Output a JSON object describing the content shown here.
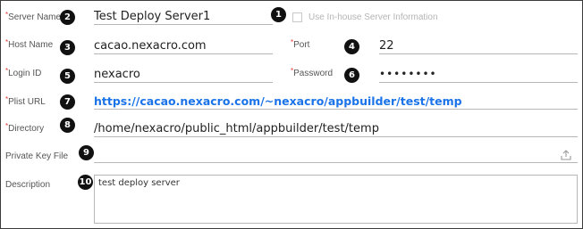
{
  "server_name": {
    "label": "Server Name",
    "value": "Test Deploy Server1",
    "badge": "2"
  },
  "use_inhouse": {
    "label": "Use In-house Server Information",
    "badge": "1",
    "checked": false
  },
  "host_name": {
    "label": "Host Name",
    "value": "cacao.nexacro.com",
    "badge": "3"
  },
  "port": {
    "label": "Port",
    "value": "22",
    "badge": "4"
  },
  "login_id": {
    "label": "Login ID",
    "value": "nexacro",
    "badge": "5"
  },
  "password": {
    "label": "Password",
    "value": "••••••••",
    "badge": "6"
  },
  "plist_url": {
    "label": "Plist URL",
    "value": "https://cacao.nexacro.com/~nexacro/appbuilder/test/temp",
    "badge": "7"
  },
  "directory": {
    "label": "Directory",
    "value": "/home/nexacro/public_html/appbuilder/test/temp",
    "badge": "8"
  },
  "private_key": {
    "label": "Private Key File",
    "value": "",
    "badge": "9",
    "icon": "upload-icon"
  },
  "description": {
    "label": "Description",
    "value": "test deploy server",
    "badge": "10"
  },
  "colors": {
    "required_marker": "#e53935",
    "link": "#1a73e8",
    "badge": "#111111"
  }
}
